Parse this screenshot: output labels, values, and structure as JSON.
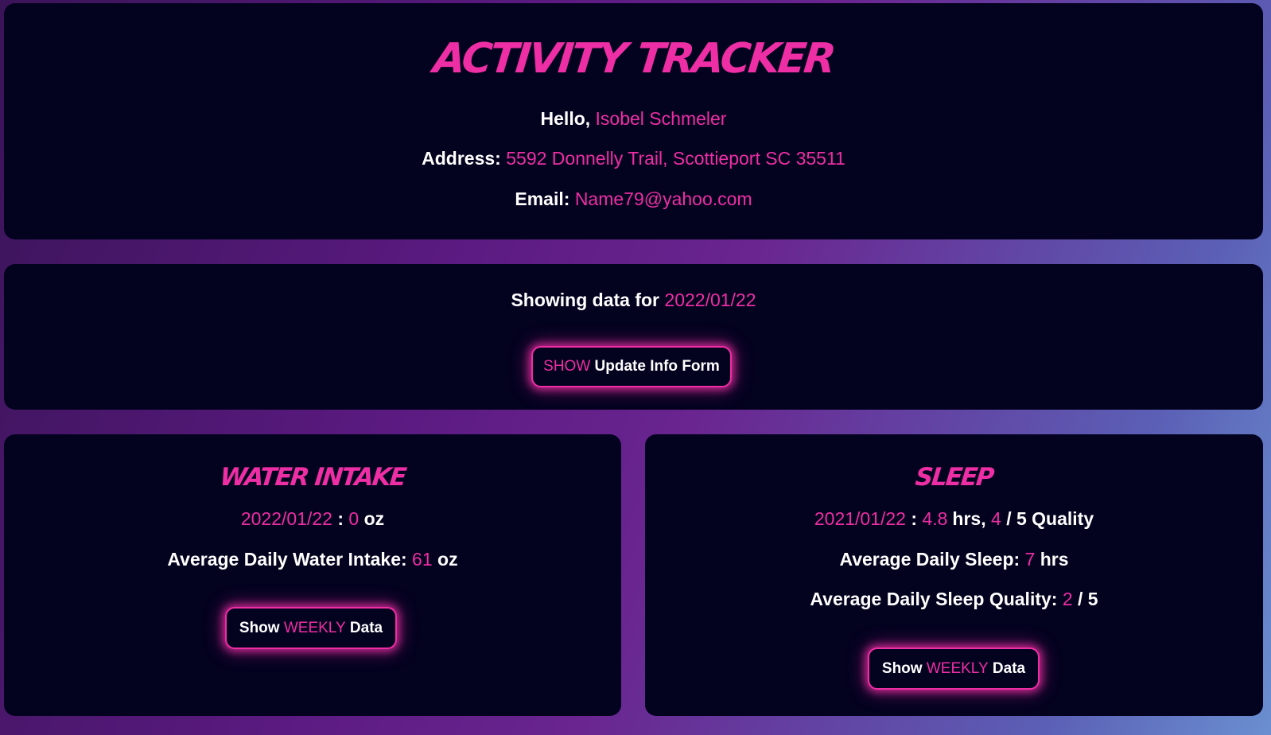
{
  "header": {
    "title": "Activity Tracker",
    "greeting_label": "Hello,",
    "user_name": "Isobel Schmeler",
    "address_label": "Address:",
    "address": "5592 Donnelly Trail, Scottieport SC 35511",
    "email_label": "Email:",
    "email": "Name79@yahoo.com"
  },
  "date_panel": {
    "showing_label": "Showing data for",
    "date": "2022/01/22",
    "update_button": {
      "prefix": "SHOW",
      "label": "Update Info Form"
    }
  },
  "water": {
    "title": "Water Intake",
    "date": "2022/01/22",
    "separator": ":",
    "amount": "0",
    "unit": "oz",
    "average_label": "Average Daily Water Intake:",
    "average_value": "61",
    "average_unit": "oz",
    "weekly_button": {
      "prefix": "Show",
      "highlight": "WEEKLY",
      "suffix": "Data"
    }
  },
  "sleep": {
    "title": "Sleep",
    "date": "2021/01/22",
    "separator": ":",
    "hours": "4.8",
    "hours_unit": "hrs,",
    "quality": "4",
    "quality_suffix": "/ 5 Quality",
    "avg_sleep_label": "Average Daily Sleep:",
    "avg_sleep_value": "7",
    "avg_sleep_unit": "hrs",
    "avg_quality_label": "Average Daily Sleep Quality:",
    "avg_quality_value": "2",
    "avg_quality_suffix": "/ 5",
    "weekly_button": {
      "prefix": "Show",
      "highlight": "WEEKLY",
      "suffix": "Data"
    }
  },
  "colors": {
    "accent": "#ee2ea4",
    "card_background": "#03021f",
    "text": "#ffffff"
  }
}
